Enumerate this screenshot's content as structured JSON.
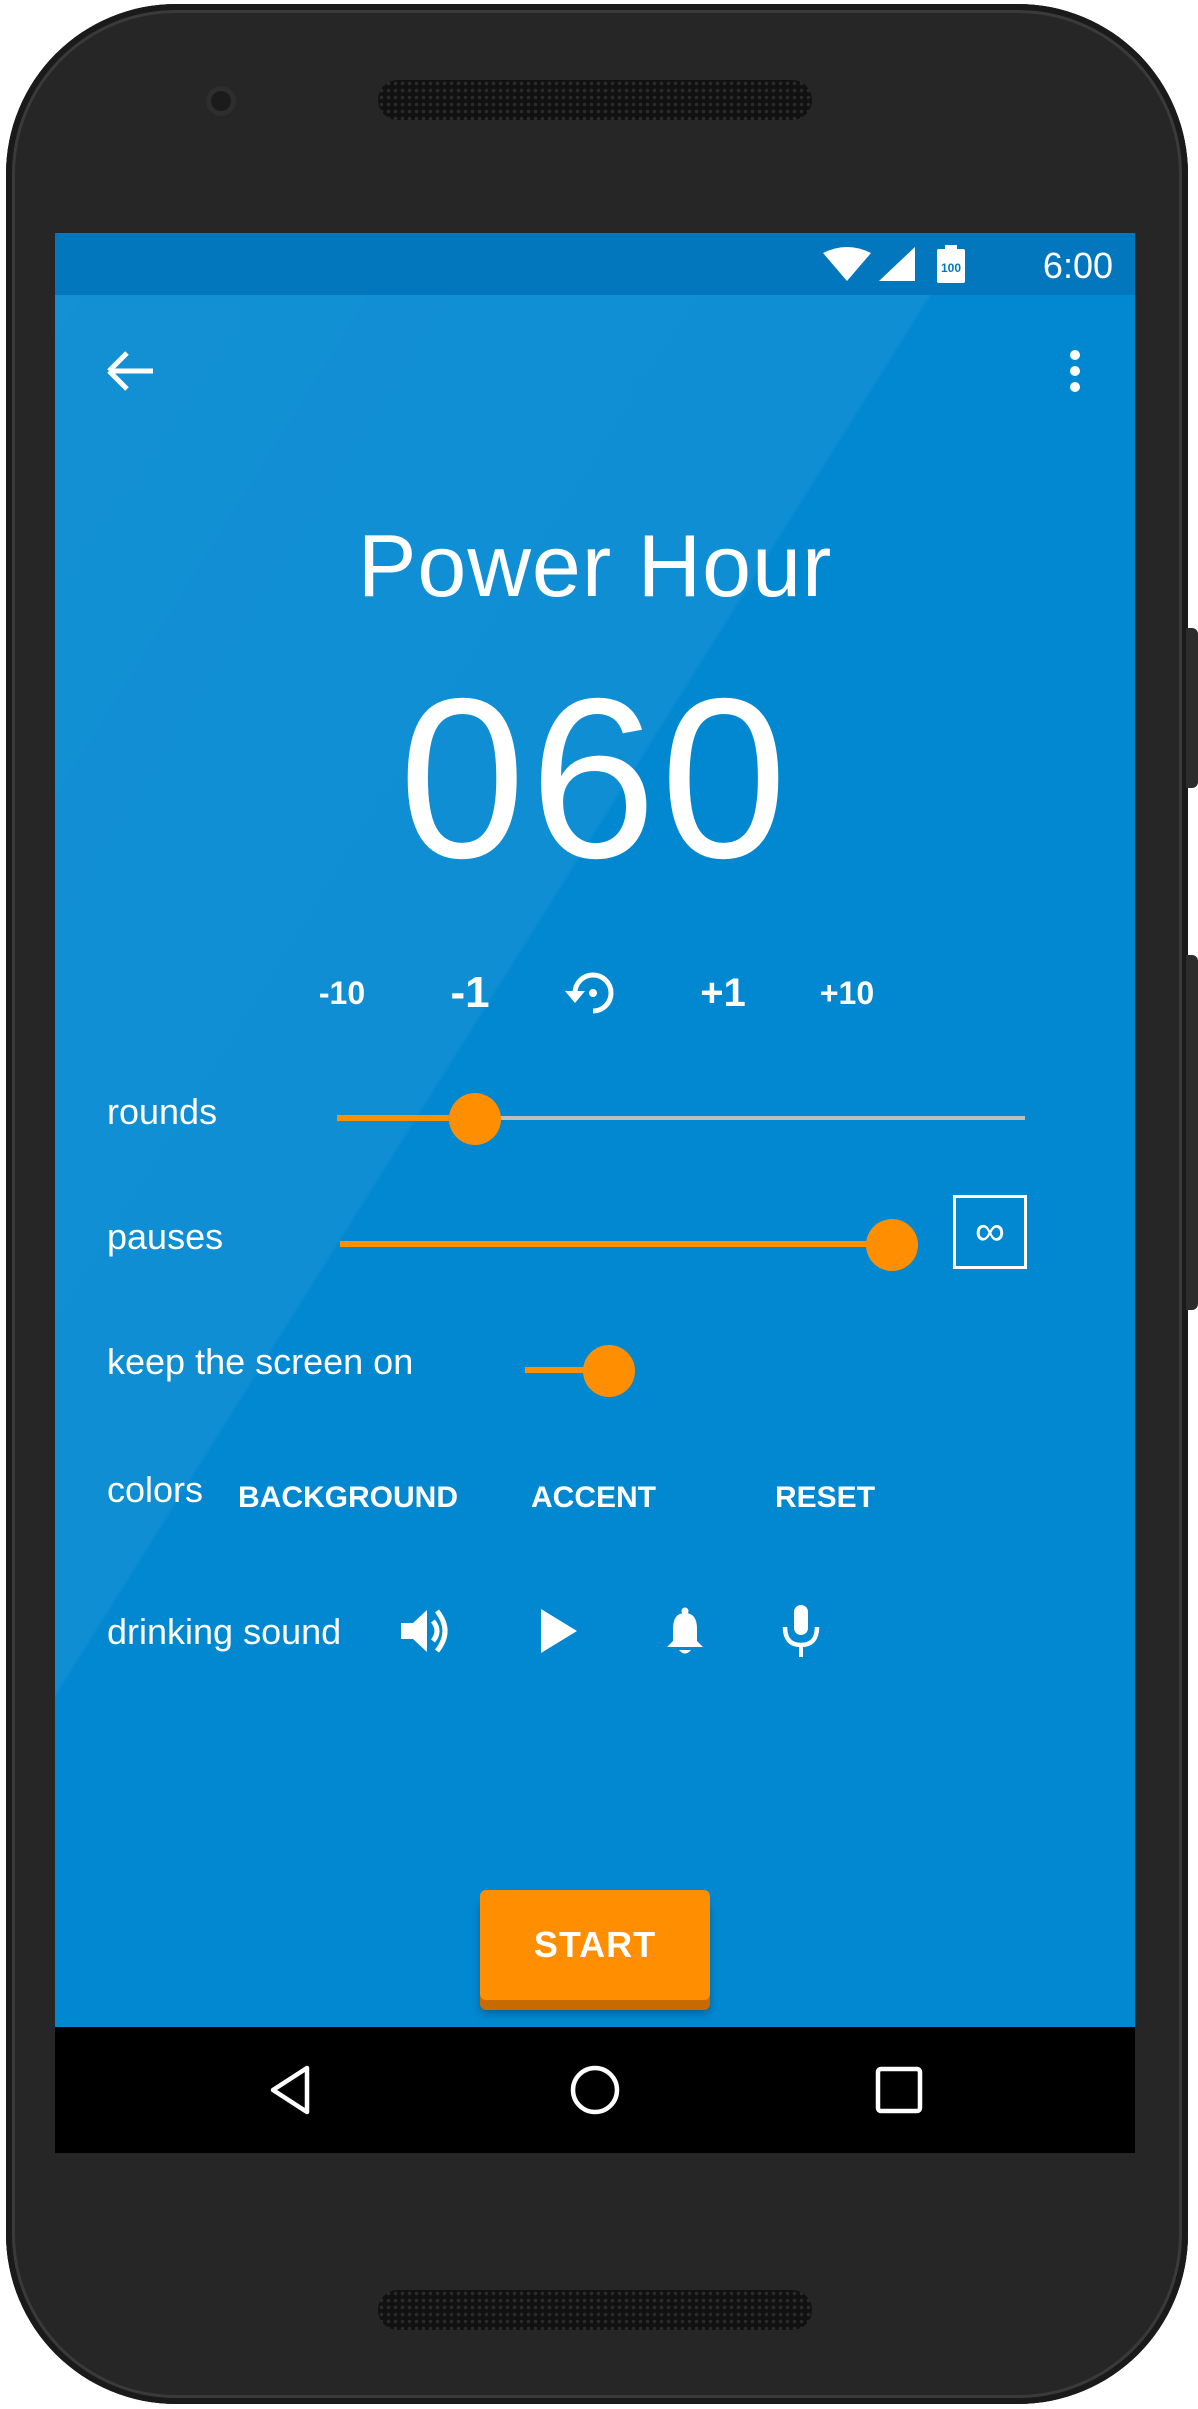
{
  "device": {
    "body_color": "#262626"
  },
  "status_bar": {
    "time": "6:00",
    "battery_level": "100",
    "icons": [
      "wifi-icon",
      "signal-icon",
      "battery-icon"
    ],
    "color": "#0277bd"
  },
  "toolbar": {
    "back_icon": "arrow-back-icon",
    "menu_icon": "more-vert-icon"
  },
  "app": {
    "title": "Power Hour",
    "counter": "060",
    "background_color": "#0288d1",
    "accent_color": "#ff8f00"
  },
  "steppers": {
    "minus_ten": "-10",
    "minus_one": "-1",
    "reset_icon": "restore-icon",
    "plus_one": "+1",
    "plus_ten": "+10"
  },
  "settings": {
    "rounds": {
      "label": "rounds",
      "value_fraction": 0.2
    },
    "pauses": {
      "label": "pauses",
      "value_fraction": 1.0,
      "infinity_symbol": "∞"
    },
    "keep_screen_on": {
      "label": "keep the screen on",
      "enabled": true
    },
    "colors": {
      "label": "colors",
      "background_button": "BACKGROUND",
      "accent_button": "ACCENT",
      "reset_button": "RESET"
    },
    "drinking_sound": {
      "label": "drinking sound",
      "icons": [
        "volume-up-icon",
        "play-icon",
        "bell-icon",
        "mic-icon"
      ]
    }
  },
  "start_button": {
    "label": "START"
  },
  "nav_bar": {
    "icons": [
      "nav-back-icon",
      "nav-home-icon",
      "nav-recents-icon"
    ]
  }
}
